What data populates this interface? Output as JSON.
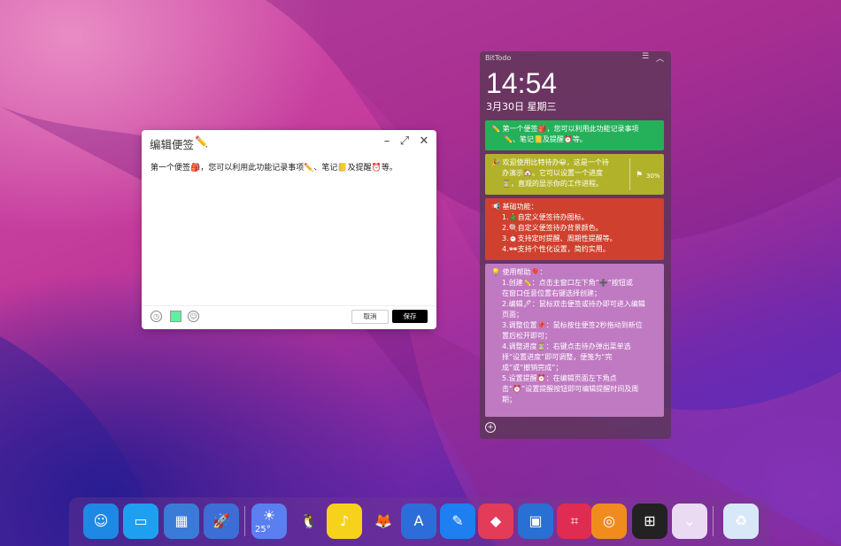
{
  "editor": {
    "title": "编辑便签",
    "title_icon": "✏️",
    "content": "第一个便签🎒，您可以利用此功能记录事项✏️、笔记📒及提醒⏰等。",
    "cancel_label": "取消",
    "save_label": "保存",
    "minimize_glyph": "–",
    "maximize_glyph": "⤢",
    "close_glyph": "✕"
  },
  "todo": {
    "app_name": "BitTodo",
    "time": "14:54",
    "date": "3月30日 星期三",
    "cards": [
      {
        "lines": [
          "✏️ 第一个便签🎒，您可以利用此功能记录事项",
          "✏️、笔记📒及提醒⏰等。"
        ]
      },
      {
        "lines": [
          "🎉 欢迎使用比特待办😀，这是一个待",
          "办演示🏠。它可以设置一个进度",
          "⏳，直观的显示你的工作进程。"
        ],
        "progress": "30%"
      },
      {
        "lines": [
          "📢 基础功能：",
          "1.🎄自定义便签待办图标。",
          "2.🍭自定义便签待办背景颜色。",
          "3.⏰支持定时提醒、周期性提醒等。",
          "4.🕶支持个性化设置，简约实用。"
        ]
      },
      {
        "lines": [
          "💡 使用帮助🎈：",
          "1.创建✏️：点击主窗口左下角“➕”按钮或",
          "在窗口任意位置右键选择创建；",
          "2.编辑🖊：鼠标双击便签或待办即可进入编辑",
          "页面；",
          "3.调整位置📌：鼠标按住便签2秒拖动到新位",
          "置后松开即可；",
          "4.调整进度⏳：右键点击待办弹出菜单选",
          "择“设置进度”即可调整，便笺为“完",
          "成”或“撤销完成”；",
          "5.设置提醒⏰：在编辑页面左下角点",
          "击“⏰”设置提醒按钮即可编辑提醒时间及周",
          "期；"
        ]
      }
    ]
  },
  "dock": {
    "items": [
      {
        "name": "finder-icon",
        "glyph": "☺",
        "color": "#1e88e5"
      },
      {
        "name": "desktop-icon",
        "glyph": "▭",
        "color": "#1ea0f0"
      },
      {
        "name": "launchpad-icon",
        "glyph": "▦",
        "color": "#3b7bd8"
      },
      {
        "name": "rocket-icon",
        "glyph": "🚀",
        "color": "#3d6ed6"
      },
      {
        "name": "weather-icon",
        "glyph": "☀",
        "color": "#5b7ff0",
        "label": "25°"
      },
      {
        "name": "qq-icon",
        "glyph": "🐧",
        "color": "transparent"
      },
      {
        "name": "music-icon",
        "glyph": "♪",
        "color": "#f7d21d"
      },
      {
        "name": "firefox-icon",
        "glyph": "🦊",
        "color": "transparent"
      },
      {
        "name": "appstore-icon",
        "glyph": "A",
        "color": "#2d6dd9"
      },
      {
        "name": "notes-pen-icon",
        "glyph": "✎",
        "color": "#1e7ff0"
      },
      {
        "name": "screenshot-icon",
        "glyph": "◆",
        "color": "#e23c59"
      },
      {
        "name": "chip-icon",
        "glyph": "▣",
        "color": "#2a6fd4"
      },
      {
        "name": "crop-icon",
        "glyph": "⌗",
        "color": "#e02b52"
      },
      {
        "name": "power-icon",
        "glyph": "◎",
        "color": "#f08c1e"
      },
      {
        "name": "windows-icon",
        "glyph": "⊞",
        "color": "#222"
      },
      {
        "name": "download-icon",
        "glyph": "⌄",
        "color": "#eadbf2"
      },
      {
        "name": "recycle-bin-icon",
        "glyph": "♻",
        "color": "#d8e8f8"
      }
    ]
  }
}
